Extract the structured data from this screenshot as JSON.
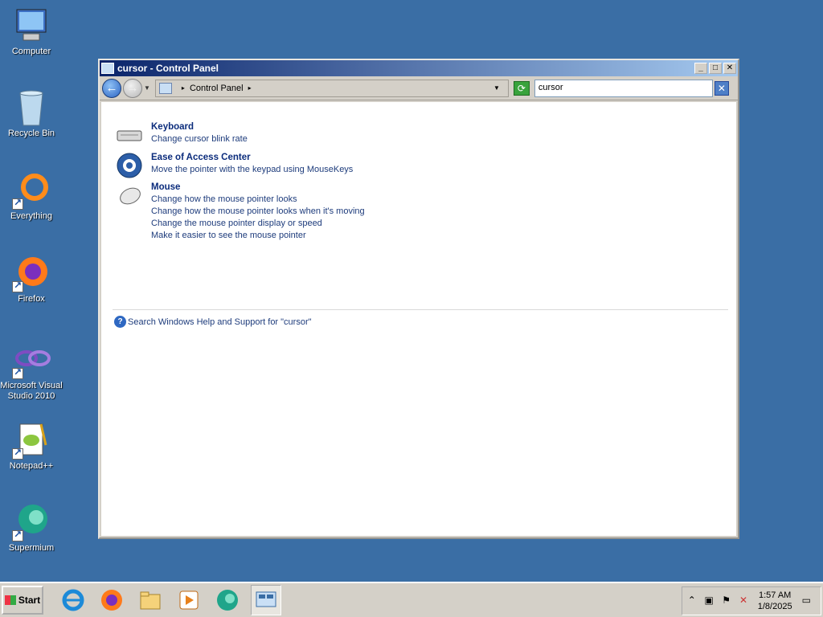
{
  "desktop": {
    "icons": [
      {
        "label": "Computer"
      },
      {
        "label": "Recycle Bin"
      },
      {
        "label": "Everything"
      },
      {
        "label": "Firefox"
      },
      {
        "label": "Microsoft Visual Studio 2010"
      },
      {
        "label": "Notepad++"
      },
      {
        "label": "Supermium"
      }
    ]
  },
  "window": {
    "title": "cursor - Control Panel",
    "minimize": "_",
    "maximize": "□",
    "close": "✕",
    "address": "Control Panel",
    "search_value": "cursor"
  },
  "results": [
    {
      "title": "Keyboard",
      "links": [
        "Change cursor blink rate"
      ]
    },
    {
      "title": "Ease of Access Center",
      "links": [
        "Move the pointer with the keypad using MouseKeys"
      ]
    },
    {
      "title": "Mouse",
      "links": [
        "Change how the mouse pointer looks",
        "Change how the mouse pointer looks when it's moving",
        "Change the mouse pointer display or speed",
        "Make it easier to see the mouse pointer"
      ]
    }
  ],
  "help_link": "Search Windows Help and Support for \"cursor\"",
  "taskbar": {
    "start_label": "Start",
    "time": "1:57 AM",
    "date": "1/8/2025"
  }
}
